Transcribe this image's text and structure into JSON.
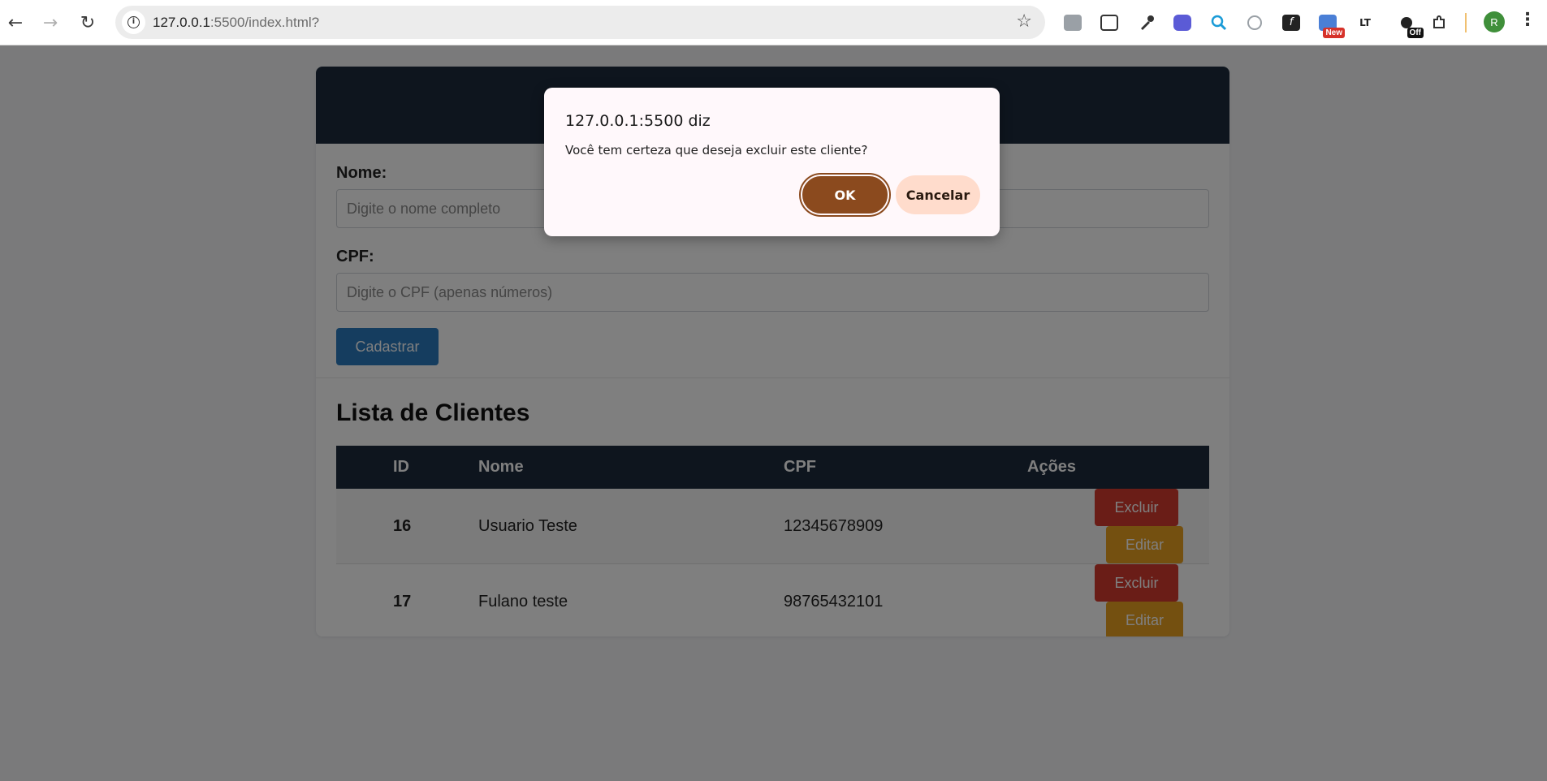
{
  "browser": {
    "url_host": "127.0.0.1",
    "url_rest": ":5500/index.html?",
    "back_icon": "←",
    "forward_icon": "→",
    "reload_icon": "↻",
    "star_icon": "☆",
    "avatar_letter": "R",
    "menu_icon": "⋮",
    "extension_badges": {
      "new": "New",
      "off": "Off"
    }
  },
  "form": {
    "name_label": "Nome:",
    "name_placeholder": "Digite o nome completo",
    "cpf_label": "CPF:",
    "cpf_placeholder": "Digite o CPF (apenas números)",
    "submit_label": "Cadastrar"
  },
  "list": {
    "title": "Lista de Clientes",
    "columns": [
      "ID",
      "Nome",
      "CPF",
      "Ações"
    ],
    "rows": [
      {
        "id": "16",
        "name": "Usuario Teste",
        "cpf": "12345678909",
        "delete_label": "Excluir",
        "edit_label": "Editar"
      },
      {
        "id": "17",
        "name": "Fulano teste",
        "cpf": "98765432101",
        "delete_label": "Excluir",
        "edit_label": "Editar"
      }
    ]
  },
  "dialog": {
    "title": "127.0.0.1:5500 diz",
    "message": "Você tem certeza que deseja excluir este cliente?",
    "ok_label": "OK",
    "cancel_label": "Cancelar"
  },
  "colors": {
    "header": "#1d2b3c",
    "primary_button": "#2b7bbf",
    "delete_button": "#d43a2f",
    "edit_button": "#e8a020",
    "dialog_ok": "#8b4a1e",
    "dialog_cancel": "#ffdccc"
  }
}
